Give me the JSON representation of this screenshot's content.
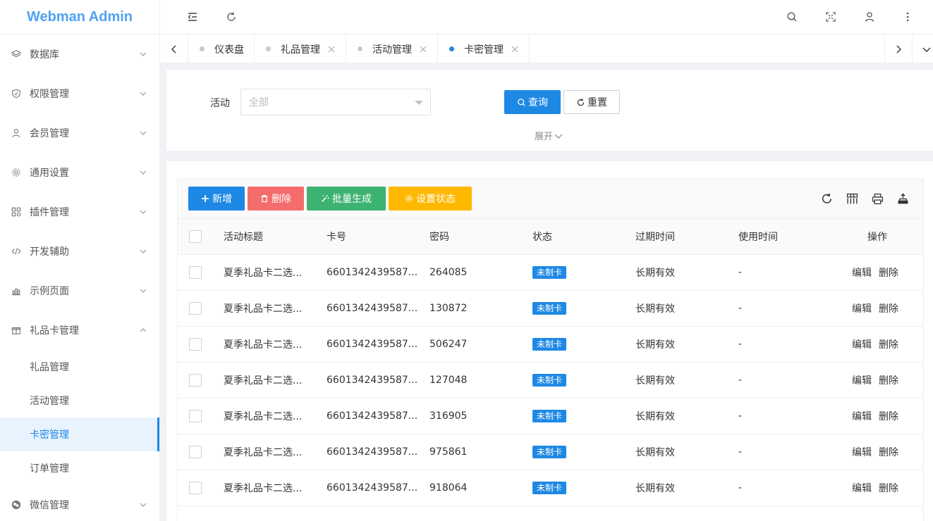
{
  "app": {
    "title": "Webman Admin"
  },
  "sidebar": {
    "items": [
      {
        "label": "数据库",
        "icon": "layers-icon"
      },
      {
        "label": "权限管理",
        "icon": "shield-icon"
      },
      {
        "label": "会员管理",
        "icon": "user-icon"
      },
      {
        "label": "通用设置",
        "icon": "gear-icon"
      },
      {
        "label": "插件管理",
        "icon": "apps-icon"
      },
      {
        "label": "开发辅助",
        "icon": "code-icon"
      },
      {
        "label": "示例页面",
        "icon": "chart-icon"
      },
      {
        "label": "礼品卡管理",
        "icon": "gift-icon"
      },
      {
        "label": "微信管理",
        "icon": "wechat-icon"
      }
    ],
    "sub_items": [
      "礼品管理",
      "活动管理",
      "卡密管理",
      "订单管理"
    ],
    "active_sub": "卡密管理"
  },
  "tabs": [
    {
      "label": "仪表盘",
      "closable": false,
      "active": false
    },
    {
      "label": "礼品管理",
      "closable": true,
      "active": false
    },
    {
      "label": "活动管理",
      "closable": true,
      "active": false
    },
    {
      "label": "卡密管理",
      "closable": true,
      "active": true
    }
  ],
  "search": {
    "label": "活动",
    "placeholder": "全部",
    "query_label": "查询",
    "reset_label": "重置",
    "expand_label": "展开"
  },
  "toolbar": {
    "add_label": "新增",
    "delete_label": "删除",
    "batch_label": "批量生成",
    "status_label": "设置状态"
  },
  "table": {
    "columns": [
      "活动标题",
      "卡号",
      "密码",
      "状态",
      "过期时间",
      "使用时间",
      "操作"
    ],
    "rows": [
      {
        "title": "夏季礼品卡二选...",
        "card": "6601342439587...",
        "password": "264085",
        "status": "未制卡",
        "expire": "长期有效",
        "used": "-"
      },
      {
        "title": "夏季礼品卡二选...",
        "card": "6601342439587...",
        "password": "130872",
        "status": "未制卡",
        "expire": "长期有效",
        "used": "-"
      },
      {
        "title": "夏季礼品卡二选...",
        "card": "6601342439587...",
        "password": "506247",
        "status": "未制卡",
        "expire": "长期有效",
        "used": "-"
      },
      {
        "title": "夏季礼品卡二选...",
        "card": "6601342439587...",
        "password": "127048",
        "status": "未制卡",
        "expire": "长期有效",
        "used": "-"
      },
      {
        "title": "夏季礼品卡二选...",
        "card": "6601342439587...",
        "password": "316905",
        "status": "未制卡",
        "expire": "长期有效",
        "used": "-"
      },
      {
        "title": "夏季礼品卡二选...",
        "card": "6601342439587...",
        "password": "975861",
        "status": "未制卡",
        "expire": "长期有效",
        "used": "-"
      },
      {
        "title": "夏季礼品卡二选...",
        "card": "6601342439587...",
        "password": "918064",
        "status": "未制卡",
        "expire": "长期有效",
        "used": "-"
      }
    ],
    "edit_label": "编辑",
    "delete_label": "删除"
  },
  "colors": {
    "primary": "#1e88e5",
    "danger": "#f56c6c",
    "success": "#3cb371",
    "warning": "#ffb800"
  }
}
